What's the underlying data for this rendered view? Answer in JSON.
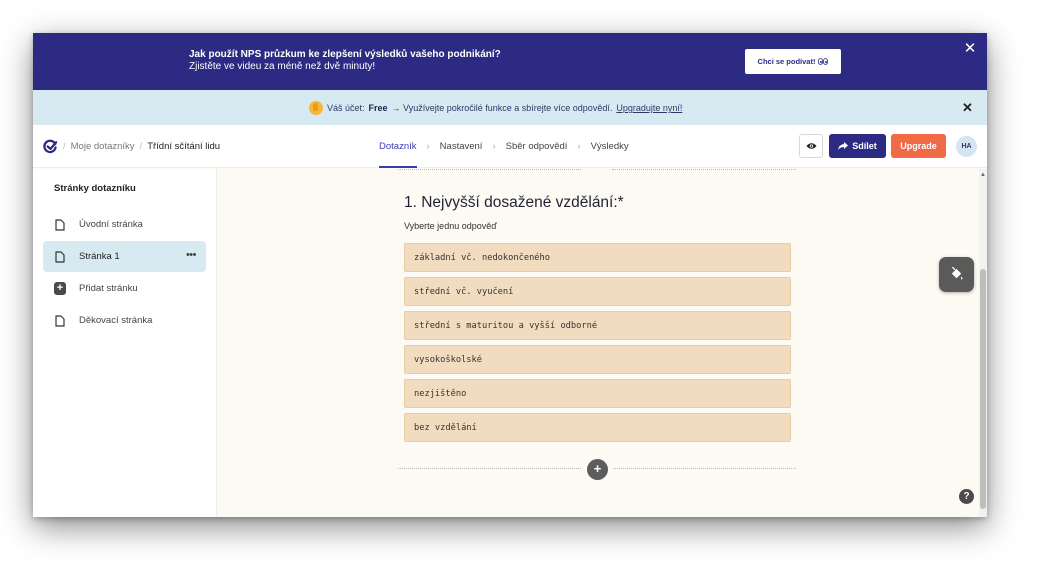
{
  "promo": {
    "title": "Jak použít NPS průzkum ke zlepšení výsledků vašeho podnikání?",
    "subtitle": "Zjistěte ve videu za méně než dvě minuty!",
    "cta_label": "Chci se podívat!",
    "close": "✕"
  },
  "account": {
    "prefix": "Váš účet:",
    "plan": "Free",
    "message": "→ Využívejte pokročilé funkce a sbírejte více odpovědí.",
    "link": "Upgradujte nyní!",
    "close": "✕"
  },
  "nav": {
    "crumbs": [
      "Moje dotazníky",
      "Třídní sčítání lidu"
    ],
    "steps": [
      "Dotazník",
      "Nastavení",
      "Sběr odpovědí",
      "Výsledky"
    ],
    "active_step": "Dotazník",
    "share_label": "Sdílet",
    "upgrade_label": "Upgrade",
    "avatar": "HA"
  },
  "sidebar": {
    "title": "Stránky dotazníku",
    "items": [
      {
        "label": "Úvodní stránka",
        "icon": "page-icon"
      },
      {
        "label": "Stránka 1",
        "icon": "page-icon",
        "active": true,
        "more": "•••"
      },
      {
        "label": "Přidat stránku",
        "icon": "plus-icon"
      },
      {
        "label": "Děkovací stránka",
        "icon": "page-icon"
      }
    ]
  },
  "question": {
    "title": "1. Nejvyšší dosažené vzdělání:*",
    "hint": "Vyberte jednu odpověď",
    "options": [
      "základní vč. nedokončeného",
      "střední vč. vyučení",
      "střední s maturitou a vyšší odborné",
      "vysokoškolské",
      "nezjištěno",
      "bez vzdělání"
    ],
    "add": "+"
  },
  "help": "?",
  "colors": {
    "brand": "#2c2a83",
    "accent": "#ef6a45",
    "option": "#f2dcbf",
    "info": "#d7eaf2"
  }
}
